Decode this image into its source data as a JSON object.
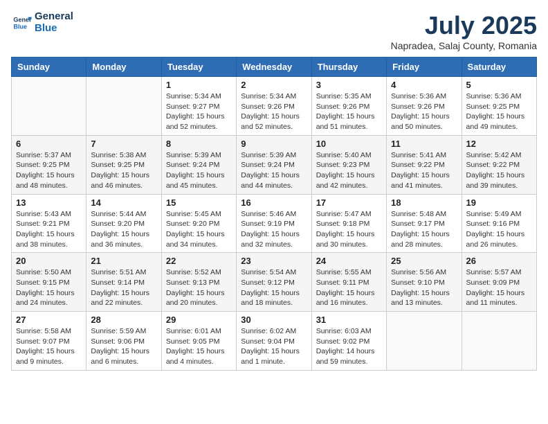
{
  "logo": {
    "line1": "General",
    "line2": "Blue"
  },
  "title": "July 2025",
  "location": "Napradea, Salaj County, Romania",
  "headers": [
    "Sunday",
    "Monday",
    "Tuesday",
    "Wednesday",
    "Thursday",
    "Friday",
    "Saturday"
  ],
  "weeks": [
    [
      {
        "day": "",
        "info": ""
      },
      {
        "day": "",
        "info": ""
      },
      {
        "day": "1",
        "info": "Sunrise: 5:34 AM\nSunset: 9:27 PM\nDaylight: 15 hours and 52 minutes."
      },
      {
        "day": "2",
        "info": "Sunrise: 5:34 AM\nSunset: 9:26 PM\nDaylight: 15 hours and 52 minutes."
      },
      {
        "day": "3",
        "info": "Sunrise: 5:35 AM\nSunset: 9:26 PM\nDaylight: 15 hours and 51 minutes."
      },
      {
        "day": "4",
        "info": "Sunrise: 5:36 AM\nSunset: 9:26 PM\nDaylight: 15 hours and 50 minutes."
      },
      {
        "day": "5",
        "info": "Sunrise: 5:36 AM\nSunset: 9:25 PM\nDaylight: 15 hours and 49 minutes."
      }
    ],
    [
      {
        "day": "6",
        "info": "Sunrise: 5:37 AM\nSunset: 9:25 PM\nDaylight: 15 hours and 48 minutes."
      },
      {
        "day": "7",
        "info": "Sunrise: 5:38 AM\nSunset: 9:25 PM\nDaylight: 15 hours and 46 minutes."
      },
      {
        "day": "8",
        "info": "Sunrise: 5:39 AM\nSunset: 9:24 PM\nDaylight: 15 hours and 45 minutes."
      },
      {
        "day": "9",
        "info": "Sunrise: 5:39 AM\nSunset: 9:24 PM\nDaylight: 15 hours and 44 minutes."
      },
      {
        "day": "10",
        "info": "Sunrise: 5:40 AM\nSunset: 9:23 PM\nDaylight: 15 hours and 42 minutes."
      },
      {
        "day": "11",
        "info": "Sunrise: 5:41 AM\nSunset: 9:22 PM\nDaylight: 15 hours and 41 minutes."
      },
      {
        "day": "12",
        "info": "Sunrise: 5:42 AM\nSunset: 9:22 PM\nDaylight: 15 hours and 39 minutes."
      }
    ],
    [
      {
        "day": "13",
        "info": "Sunrise: 5:43 AM\nSunset: 9:21 PM\nDaylight: 15 hours and 38 minutes."
      },
      {
        "day": "14",
        "info": "Sunrise: 5:44 AM\nSunset: 9:20 PM\nDaylight: 15 hours and 36 minutes."
      },
      {
        "day": "15",
        "info": "Sunrise: 5:45 AM\nSunset: 9:20 PM\nDaylight: 15 hours and 34 minutes."
      },
      {
        "day": "16",
        "info": "Sunrise: 5:46 AM\nSunset: 9:19 PM\nDaylight: 15 hours and 32 minutes."
      },
      {
        "day": "17",
        "info": "Sunrise: 5:47 AM\nSunset: 9:18 PM\nDaylight: 15 hours and 30 minutes."
      },
      {
        "day": "18",
        "info": "Sunrise: 5:48 AM\nSunset: 9:17 PM\nDaylight: 15 hours and 28 minutes."
      },
      {
        "day": "19",
        "info": "Sunrise: 5:49 AM\nSunset: 9:16 PM\nDaylight: 15 hours and 26 minutes."
      }
    ],
    [
      {
        "day": "20",
        "info": "Sunrise: 5:50 AM\nSunset: 9:15 PM\nDaylight: 15 hours and 24 minutes."
      },
      {
        "day": "21",
        "info": "Sunrise: 5:51 AM\nSunset: 9:14 PM\nDaylight: 15 hours and 22 minutes."
      },
      {
        "day": "22",
        "info": "Sunrise: 5:52 AM\nSunset: 9:13 PM\nDaylight: 15 hours and 20 minutes."
      },
      {
        "day": "23",
        "info": "Sunrise: 5:54 AM\nSunset: 9:12 PM\nDaylight: 15 hours and 18 minutes."
      },
      {
        "day": "24",
        "info": "Sunrise: 5:55 AM\nSunset: 9:11 PM\nDaylight: 15 hours and 16 minutes."
      },
      {
        "day": "25",
        "info": "Sunrise: 5:56 AM\nSunset: 9:10 PM\nDaylight: 15 hours and 13 minutes."
      },
      {
        "day": "26",
        "info": "Sunrise: 5:57 AM\nSunset: 9:09 PM\nDaylight: 15 hours and 11 minutes."
      }
    ],
    [
      {
        "day": "27",
        "info": "Sunrise: 5:58 AM\nSunset: 9:07 PM\nDaylight: 15 hours and 9 minutes."
      },
      {
        "day": "28",
        "info": "Sunrise: 5:59 AM\nSunset: 9:06 PM\nDaylight: 15 hours and 6 minutes."
      },
      {
        "day": "29",
        "info": "Sunrise: 6:01 AM\nSunset: 9:05 PM\nDaylight: 15 hours and 4 minutes."
      },
      {
        "day": "30",
        "info": "Sunrise: 6:02 AM\nSunset: 9:04 PM\nDaylight: 15 hours and 1 minute."
      },
      {
        "day": "31",
        "info": "Sunrise: 6:03 AM\nSunset: 9:02 PM\nDaylight: 14 hours and 59 minutes."
      },
      {
        "day": "",
        "info": ""
      },
      {
        "day": "",
        "info": ""
      }
    ]
  ]
}
